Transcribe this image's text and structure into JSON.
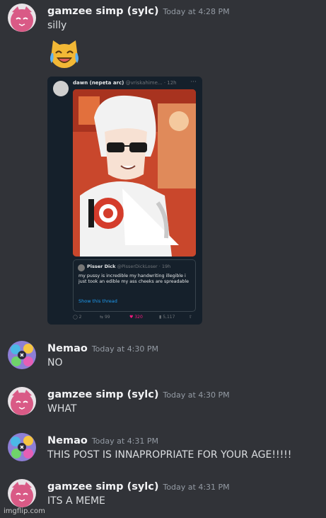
{
  "messages": [
    {
      "username": "gamzee simp (sylc)",
      "timestamp": "Today at 4:28 PM",
      "text": "silly",
      "emoji": "joy-cat",
      "embed": {
        "author_name": "dawn (nepeta arc)",
        "author_handle": "@vriskahime...",
        "author_time": "· 12h",
        "more": "···",
        "quote": {
          "name": "Pisser Dick",
          "handle": "@PisserDickLoser",
          "time": "· 19h",
          "text": "my pussy is incredible my handwriting illegible i just took an edible my ass cheeks are spreadable",
          "link": "Show this thread"
        },
        "replies": "2",
        "retweets": "99",
        "likes": "320",
        "views": "5,117"
      }
    },
    {
      "username": "Nemao",
      "timestamp": "Today at 4:30 PM",
      "text": "NO"
    },
    {
      "username": "gamzee simp (sylc)",
      "timestamp": "Today at 4:30 PM",
      "text": "WHAT"
    },
    {
      "username": "Nemao",
      "timestamp": "Today at 4:31 PM",
      "text": "THIS POST IS INNAPROPRIATE FOR YOUR AGE!!!!!"
    },
    {
      "username": "gamzee simp (sylc)",
      "timestamp": "Today at 4:31 PM",
      "text": "ITS A MEME"
    }
  ],
  "watermark": "imgflip.com",
  "colors": {
    "background": "#313338",
    "username": "#f2f3f5",
    "timestamp": "#949ba4",
    "message_text": "#dbdee1",
    "embed_bg": "#15202b",
    "link": "#1d9bf0",
    "like": "#f91880"
  }
}
